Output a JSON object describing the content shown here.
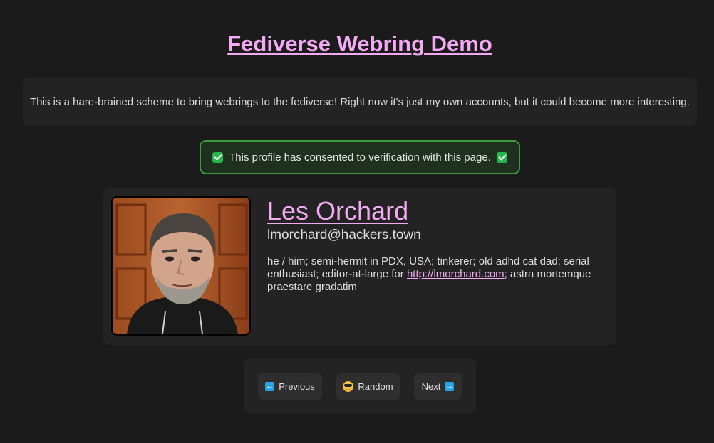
{
  "page": {
    "title": "Fediverse Webring Demo",
    "intro": "This is a hare-brained scheme to bring webrings to the fediverse! Right now it's just my own accounts, but it could become more interesting."
  },
  "verification": {
    "text": "This profile has consented to verification with this page.",
    "icon": "check-mark-icon",
    "color": "#3a9c3a"
  },
  "profile": {
    "name": "Les Orchard",
    "handle": "lmorchard@hackers.town",
    "bio_before": "he / him; semi-hermit in PDX, USA; tinkerer; old adhd cat dad; serial enthusiast; editor-at-large for ",
    "bio_link": "http://lmorchard.com",
    "bio_after": "; astra mortemque praestare gradatim",
    "avatar_alt": "avatar"
  },
  "nav": {
    "previous": "Previous",
    "random": "Random",
    "next": "Next",
    "previous_icon": "left-arrow-icon",
    "random_icon": "sunglasses-face-icon",
    "next_icon": "right-arrow-icon"
  },
  "colors": {
    "accent": "#f3a9f3",
    "background": "#1b1b1b",
    "panel": "#232323"
  }
}
